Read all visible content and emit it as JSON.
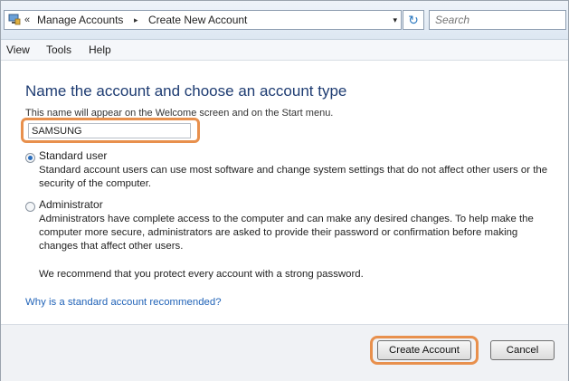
{
  "address_bar": {
    "chevron": "«",
    "crumbs": [
      "Manage Accounts",
      "Create New Account"
    ],
    "separator": "▸",
    "dropdown": "▾",
    "refresh": "↻"
  },
  "search": {
    "placeholder": "Search"
  },
  "menu": [
    "View",
    "Tools",
    "Help"
  ],
  "main": {
    "heading": "Name the account and choose an account type",
    "hint": "This name will appear on the Welcome screen and on the Start menu.",
    "account_name": "SAMSUNG",
    "options": [
      {
        "label": "Standard user",
        "selected": true,
        "description": "Standard account users can use most software and change system settings that do not affect other users or the security of the computer."
      },
      {
        "label": "Administrator",
        "selected": false,
        "description": "Administrators have complete access to the computer and can make any desired changes. To help make the computer more secure, administrators are asked to provide their password or confirmation before making changes that affect other users."
      }
    ],
    "recommendation": "We recommend that you protect every account with a strong password.",
    "link": "Why is a standard account recommended?"
  },
  "buttons": {
    "create": "Create Account",
    "cancel": "Cancel"
  },
  "colors": {
    "highlight": "#e8904d",
    "heading": "#1e3c72",
    "link": "#2264b8"
  }
}
